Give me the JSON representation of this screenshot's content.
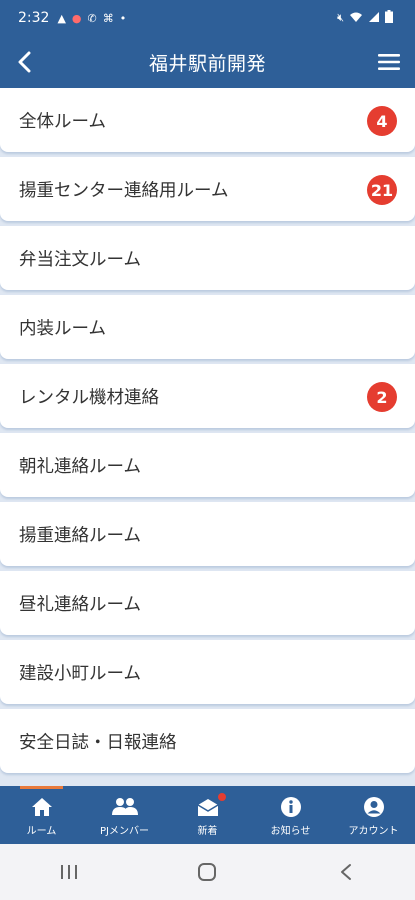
{
  "status_bar": {
    "time": "2:32"
  },
  "header": {
    "title": "福井駅前開発"
  },
  "rooms": [
    {
      "label": "全体ルーム",
      "badge": "4"
    },
    {
      "label": "揚重センター連絡用ルーム",
      "badge": "21"
    },
    {
      "label": "弁当注文ルーム",
      "badge": ""
    },
    {
      "label": "内装ルーム",
      "badge": ""
    },
    {
      "label": "レンタル機材連絡",
      "badge": "2"
    },
    {
      "label": "朝礼連絡ルーム",
      "badge": ""
    },
    {
      "label": "揚重連絡ルーム",
      "badge": ""
    },
    {
      "label": "昼礼連絡ルーム",
      "badge": ""
    },
    {
      "label": "建設小町ルーム",
      "badge": ""
    },
    {
      "label": "安全日誌・日報連絡",
      "badge": ""
    }
  ],
  "tabs": [
    {
      "label": "ルーム",
      "icon": "home-icon"
    },
    {
      "label": "PJメンバー",
      "icon": "members-icon"
    },
    {
      "label": "新着",
      "icon": "new-mail-icon"
    },
    {
      "label": "お知らせ",
      "icon": "info-icon"
    },
    {
      "label": "アカウント",
      "icon": "account-icon"
    }
  ],
  "colors": {
    "primary": "#2e5f98",
    "badge": "#e53d30",
    "active_tab": "#e87a3c",
    "list_bg": "#dfe7f2"
  }
}
